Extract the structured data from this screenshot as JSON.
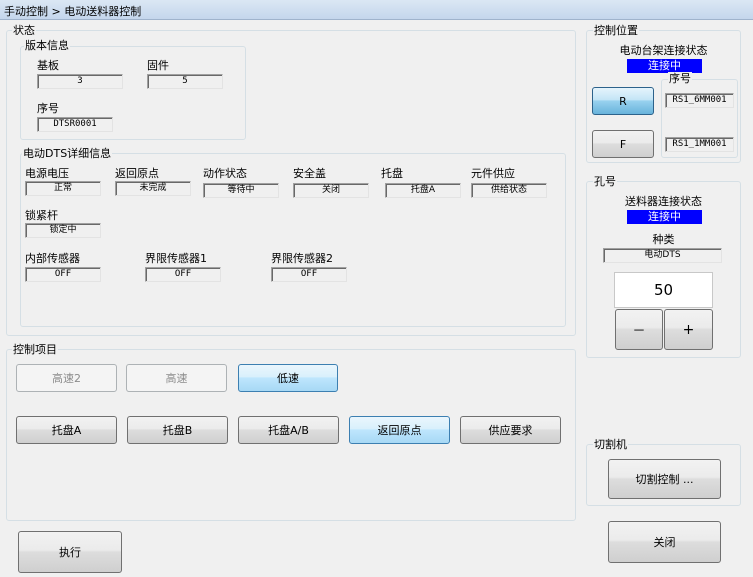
{
  "window": {
    "breadcrumb": "手动控制 > 电动送料器控制"
  },
  "status": {
    "label": "状态",
    "version": {
      "label": "版本信息",
      "board_label": "基板",
      "board_value": "3",
      "firmware_label": "固件",
      "firmware_value": "5",
      "serial_label": "序号",
      "serial_value": "DTSR0001"
    },
    "detail": {
      "label": "电动DTS详细信息",
      "items": [
        {
          "label": "电源电压",
          "value": "正常"
        },
        {
          "label": "返回原点",
          "value": "未完成"
        },
        {
          "label": "动作状态",
          "value": "等待中"
        },
        {
          "label": "安全盖",
          "value": "关闭"
        },
        {
          "label": "托盘",
          "value": "托盘A"
        },
        {
          "label": "元件供应",
          "value": "供给状态"
        },
        {
          "label": "锁紧杆",
          "value": "锁定中"
        }
      ],
      "sensors": [
        {
          "label": "内部传感器",
          "value": "OFF"
        },
        {
          "label": "界限传感器1",
          "value": "OFF"
        },
        {
          "label": "界限传感器2",
          "value": "OFF"
        }
      ]
    }
  },
  "control_items": {
    "label": "控制项目",
    "speed_buttons": [
      "高速2",
      "高速",
      "低速"
    ],
    "action_buttons": [
      "托盘A",
      "托盘B",
      "托盘A/B",
      "返回原点",
      "供应要求"
    ]
  },
  "execute_label": "执行",
  "control_position": {
    "label": "控制位置",
    "conn_label": "电动台架连接状态",
    "conn_value": "连接中",
    "serial_label": "序号",
    "r_button": "R",
    "f_button": "F",
    "r_serial": "RS1_6MM001",
    "f_serial": "RS1_1MM001"
  },
  "hole": {
    "label": "孔号",
    "conn_label": "送料器连接状态",
    "conn_value": "连接中",
    "type_label": "种类",
    "type_value": "电动DTS",
    "value": "50",
    "minus": "－",
    "plus": "+"
  },
  "cutter": {
    "label": "切割机",
    "button": "切割控制 ..."
  },
  "close_label": "关闭",
  "colors": {
    "status_blue": "#0000ff",
    "titlebar": "#c4d6ec"
  }
}
